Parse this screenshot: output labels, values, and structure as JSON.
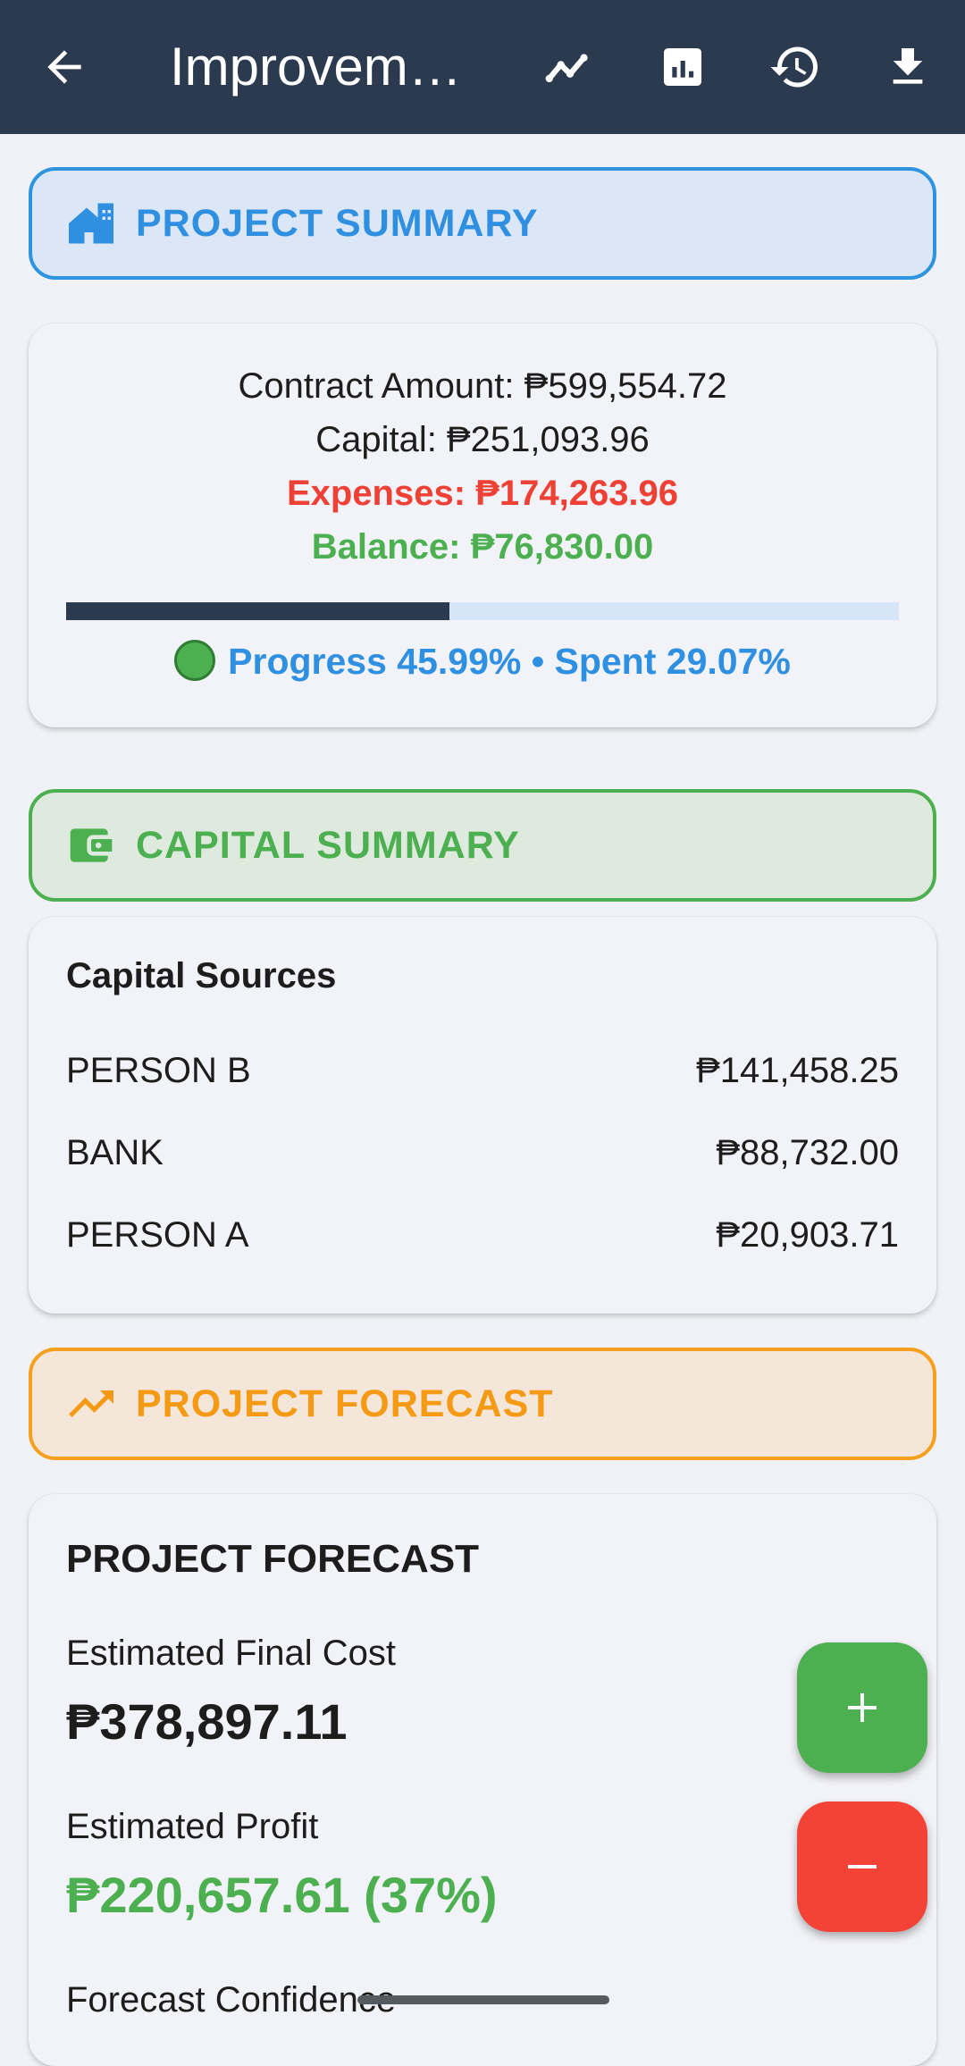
{
  "appbar": {
    "title": "Improvem…",
    "icons": [
      "back-arrow-icon",
      "trend-line-icon",
      "bar-chart-icon",
      "history-icon",
      "download-icon"
    ]
  },
  "project_summary": {
    "header": "PROJECT SUMMARY",
    "icon": "house-building-icon",
    "contract_amount": "Contract Amount: ₱599,554.72",
    "capital": "Capital: ₱251,093.96",
    "expenses": "Expenses: ₱174,263.96",
    "balance": "Balance: ₱76,830.00",
    "progress_fraction": 0.4599,
    "progress_text": "Progress 45.99% • Spent 29.07%"
  },
  "capital_summary": {
    "header": "CAPITAL SUMMARY",
    "icon": "wallet-icon",
    "title": "Capital Sources",
    "sources": [
      {
        "name": "PERSON B",
        "amount": "₱141,458.25"
      },
      {
        "name": "BANK",
        "amount": "₱88,732.00"
      },
      {
        "name": "PERSON A",
        "amount": "₱20,903.71"
      }
    ]
  },
  "project_forecast": {
    "header": "PROJECT FORECAST",
    "icon": "trending-up-icon",
    "title": "PROJECT FORECAST",
    "final_cost_label": "Estimated Final Cost",
    "final_cost_value": "₱378,897.11",
    "profit_label": "Estimated Profit",
    "profit_value": "₱220,657.61 (37%)",
    "confidence_label": "Forecast Confidence"
  },
  "fabs": {
    "add": "+",
    "subtract": "−"
  },
  "colors": {
    "appbar": "#2b3a4e",
    "blue": "#2f8fe0",
    "green": "#4caf50",
    "orange": "#f59a14",
    "red": "#ee4035"
  }
}
